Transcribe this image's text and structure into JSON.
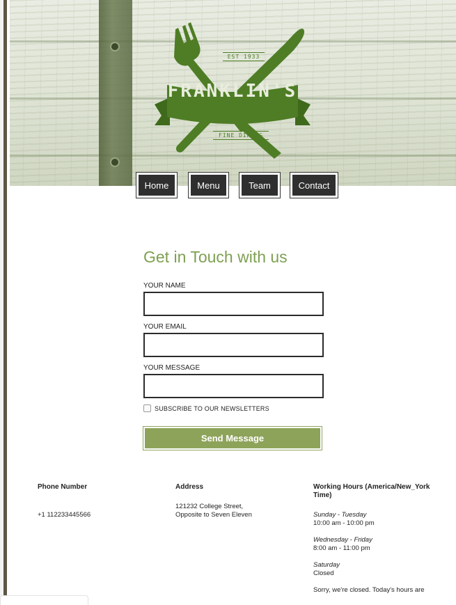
{
  "brand": {
    "name": "FRANKLIN'S",
    "est": "EST 1933",
    "tagline": "FINE DINING"
  },
  "nav": {
    "items": [
      {
        "label": "Home"
      },
      {
        "label": "Menu"
      },
      {
        "label": "Team"
      },
      {
        "label": "Contact"
      }
    ]
  },
  "contact": {
    "title": "Get in Touch with us",
    "name_label": "YOUR NAME",
    "name_value": "",
    "email_label": "YOUR EMAIL",
    "email_value": "",
    "message_label": "YOUR MESSAGE",
    "message_value": "",
    "subscribe_label": "SUBSCRIBE TO OUR NEWSLETTERS",
    "subscribe_checked": false,
    "send_label": "Send Message"
  },
  "info": {
    "phone_heading": "Phone Number",
    "phone_value": "+1 112233445566",
    "address_heading": "Address",
    "address_line1": "121232 College Street,",
    "address_line2": "Opposite to Seven Eleven",
    "hours_heading": "Working Hours (America/New_York Time)",
    "hours": [
      {
        "days": "Sunday - Tuesday",
        "time": "10:00 am - 10:00 pm"
      },
      {
        "days": "Wednesday - Friday",
        "time": "8:00 am - 11:00 pm"
      },
      {
        "days": "Saturday",
        "time": "Closed"
      }
    ],
    "status_note": "Sorry, we're closed. Today's hours are"
  },
  "colors": {
    "accent_green": "#7ea052",
    "button_green": "#8ea35a",
    "logo_green": "#4e7d25",
    "nav_dark": "#2f2f2f",
    "left_border": "#5e5645"
  },
  "icons": {
    "fork": "fork-icon",
    "knife": "knife-icon"
  }
}
